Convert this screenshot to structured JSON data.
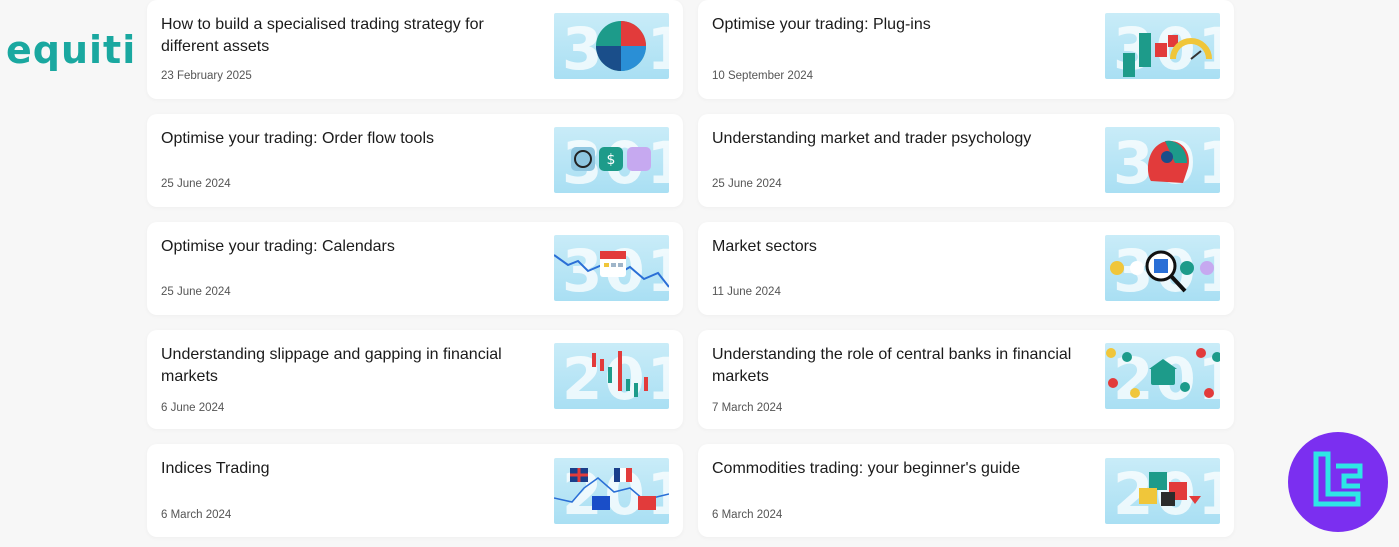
{
  "brand": {
    "logo_text": "equiti",
    "color": "#1aa8a0"
  },
  "articles": [
    {
      "title": "How to build a specialised trading strategy for different assets",
      "date": "23 February 2025",
      "thumb_num": "301"
    },
    {
      "title": "Optimise your trading: Plug-ins",
      "date": "10 September 2024",
      "thumb_num": "301"
    },
    {
      "title": "Optimise your trading: Order flow tools",
      "date": "25 June 2024",
      "thumb_num": "301"
    },
    {
      "title": "Understanding market and trader psychology",
      "date": "25 June 2024",
      "thumb_num": "301"
    },
    {
      "title": "Optimise your trading: Calendars",
      "date": "25 June 2024",
      "thumb_num": "301"
    },
    {
      "title": "Market sectors",
      "date": "11 June 2024",
      "thumb_num": "301"
    },
    {
      "title": "Understanding slippage and gapping in financial markets",
      "date": "6 June 2024",
      "thumb_num": "201"
    },
    {
      "title": "Understanding the role of central banks in financial markets",
      "date": "7 March 2024",
      "thumb_num": "201"
    },
    {
      "title": "Indices Trading",
      "date": "6 March 2024",
      "thumb_num": "201"
    },
    {
      "title": "Commodities trading: your beginner's guide",
      "date": "6 March 2024",
      "thumb_num": "201"
    }
  ],
  "badge": {
    "color": "#7b2ff0",
    "accent": "#2ee6e6",
    "icon": "tc-logo-icon"
  }
}
